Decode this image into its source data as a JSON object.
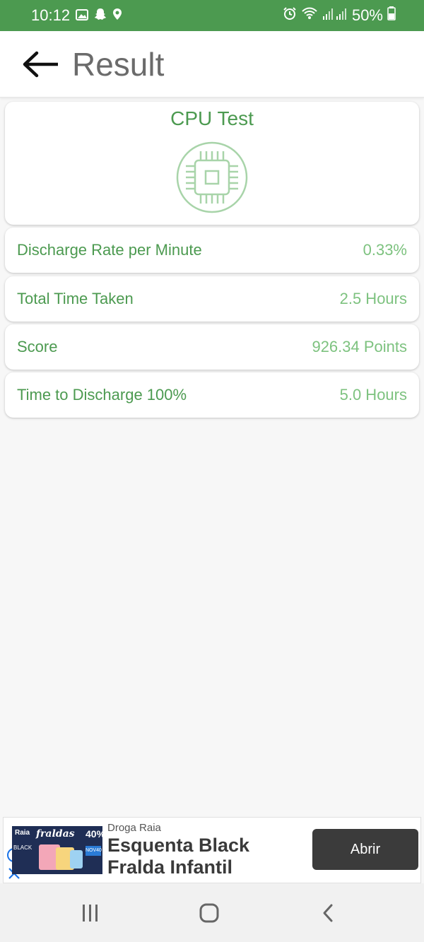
{
  "status_bar": {
    "time": "10:12",
    "battery_percent": "50%",
    "icons": [
      "image-icon",
      "snapchat-icon",
      "location-icon",
      "alarm-icon",
      "wifi-icon",
      "signal-icon",
      "battery-icon"
    ]
  },
  "app_bar": {
    "title": "Result",
    "back_icon": "arrow-left-icon"
  },
  "test": {
    "title": "CPU Test",
    "icon": "cpu-chip-icon",
    "accent_color": "#4c9a50",
    "value_color": "#7dc27f"
  },
  "results": [
    {
      "label": "Discharge Rate per Minute",
      "value": "0.33%"
    },
    {
      "label": "Total Time Taken",
      "value": "2.5 Hours"
    },
    {
      "label": "Score",
      "value": "926.34 Points"
    },
    {
      "label": "Time to Discharge 100%",
      "value": "5.0 Hours"
    }
  ],
  "ad": {
    "advertiser": "Droga Raia",
    "headline": "Esquenta Black Fralda Infantil",
    "cta": "Abrir",
    "image_texts": {
      "brand": "Raia",
      "product": "fraldas",
      "discount": "40%",
      "promo": "BLACK",
      "badge": "NOV40"
    }
  },
  "nav_bar": {
    "recents_icon": "recents-icon",
    "home_icon": "home-icon",
    "back_icon": "back-icon"
  }
}
